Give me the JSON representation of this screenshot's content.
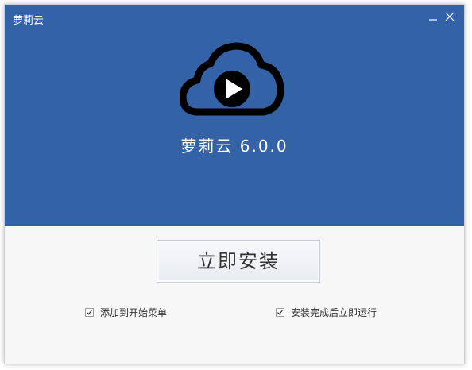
{
  "window": {
    "title": "萝莉云",
    "minimize_icon": "minimize-icon",
    "close_icon": "close-icon"
  },
  "header": {
    "logo_icon": "cloud-play-icon",
    "app_name": "萝莉云 6.0.0",
    "background_color": "#3462a6"
  },
  "install": {
    "button_label": "立即安装"
  },
  "options": [
    {
      "label": "添加到开始菜单",
      "checked": true
    },
    {
      "label": "安装完成后立即运行",
      "checked": true
    }
  ]
}
